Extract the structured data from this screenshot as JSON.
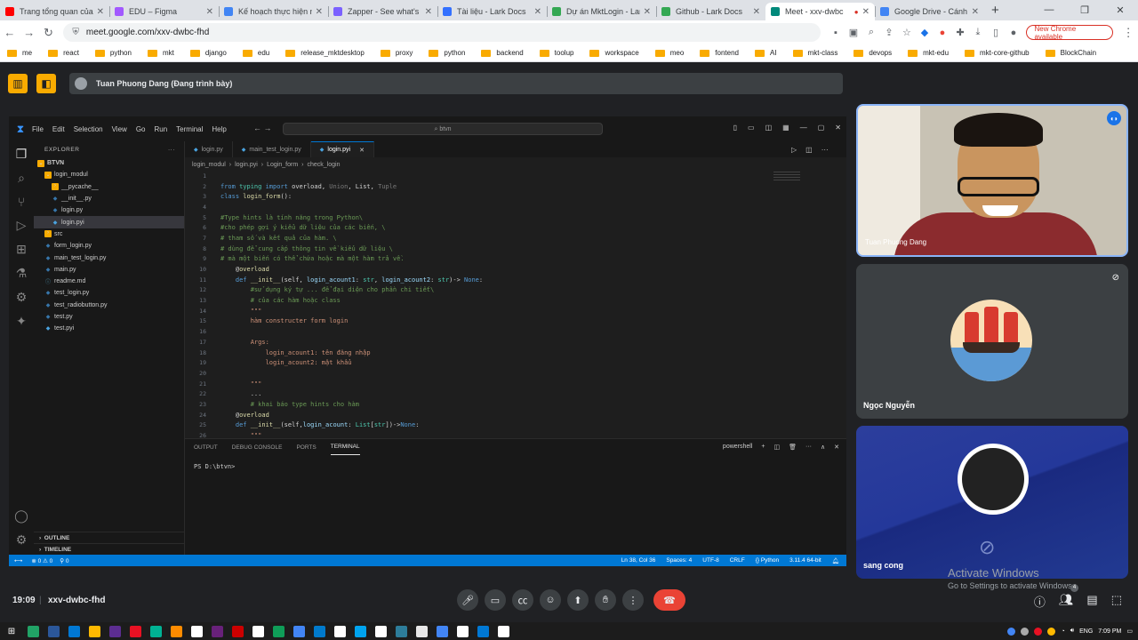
{
  "browser": {
    "tabs": [
      {
        "title": "Trang tổng quan của k",
        "color": "#ff0000"
      },
      {
        "title": "EDU – Figma",
        "color": "#a259ff"
      },
      {
        "title": "Kế hoạch thực hiện nh",
        "color": "#4285f4"
      },
      {
        "title": "Zapper - See what's h",
        "color": "#7b61ff"
      },
      {
        "title": "Tài liệu - Lark Docs",
        "color": "#3370ff"
      },
      {
        "title": "Dự án MktLogin - Lar",
        "color": "#34a853"
      },
      {
        "title": "Github - Lark Docs",
        "color": "#34a853"
      },
      {
        "title": "Meet - xxv-dwbc",
        "color": "#00897b"
      },
      {
        "title": "Google Drive - Cánh c",
        "color": "#4285f4"
      }
    ],
    "active_tab": 7,
    "new_tab": "+",
    "url": "meet.google.com/xxv-dwbc-fhd",
    "new_chrome": "New Chrome available",
    "bookmarks": [
      "me",
      "react",
      "python",
      "mkt",
      "django",
      "edu",
      "release_mktdesktop",
      "proxy",
      "python",
      "backend",
      "toolup",
      "workspace",
      "meo",
      "fontend",
      "AI",
      "mkt-class",
      "devops",
      "mkt-edu",
      "mkt-core-github",
      "BlockChain"
    ]
  },
  "meet": {
    "presenter": "Tuan Phuong Dang (Đang trình bày)",
    "time": "19:09",
    "meeting_code": "xxv-dwbc-fhd",
    "participants": [
      "Tuan Phuong Dang",
      "Ngọc Nguyễn",
      "sang cong"
    ],
    "people_badge": "4",
    "activate_title": "Activate Windows",
    "activate_sub": "Go to Settings to activate Windows."
  },
  "vscode": {
    "menu": [
      "File",
      "Edit",
      "Selection",
      "View",
      "Go",
      "Run",
      "Terminal",
      "Help"
    ],
    "search": "btvn",
    "explorer_title": "EXPLORER",
    "tree": [
      {
        "label": "BTVN",
        "indent": 0,
        "icon": "⌄",
        "kind": "folder",
        "bold": true
      },
      {
        "label": "login_modul",
        "indent": 1,
        "icon": "⌄",
        "kind": "folder"
      },
      {
        "label": "__pycache__",
        "indent": 2,
        "icon": "›",
        "kind": "folder"
      },
      {
        "label": "__init__.py",
        "indent": 2,
        "icon": "◆",
        "kind": "py"
      },
      {
        "label": "login.py",
        "indent": 2,
        "icon": "◆",
        "kind": "py"
      },
      {
        "label": "login.pyi",
        "indent": 2,
        "icon": "◆",
        "kind": "pyi",
        "selected": true
      },
      {
        "label": "src",
        "indent": 1,
        "icon": "›",
        "kind": "folder"
      },
      {
        "label": "form_login.py",
        "indent": 1,
        "icon": "◆",
        "kind": "py"
      },
      {
        "label": "main_test_login.py",
        "indent": 1,
        "icon": "◆",
        "kind": "py"
      },
      {
        "label": "main.py",
        "indent": 1,
        "icon": "◆",
        "kind": "py"
      },
      {
        "label": "readme.md",
        "indent": 1,
        "icon": "ⓘ",
        "kind": "md"
      },
      {
        "label": "test_login.py",
        "indent": 1,
        "icon": "◆",
        "kind": "py"
      },
      {
        "label": "test_radiobutton.py",
        "indent": 1,
        "icon": "◆",
        "kind": "py"
      },
      {
        "label": "test.py",
        "indent": 1,
        "icon": "◆",
        "kind": "py"
      },
      {
        "label": "test.pyi",
        "indent": 1,
        "icon": "◆",
        "kind": "pyi"
      }
    ],
    "outline": "OUTLINE",
    "timeline": "TIMELINE",
    "editor_tabs": [
      {
        "label": "login.py",
        "active": false
      },
      {
        "label": "main_test_login.py",
        "active": false
      },
      {
        "label": "login.pyi",
        "active": true
      }
    ],
    "breadcrumb": [
      "login_modul",
      "login.pyi",
      "Login_form",
      "check_login"
    ],
    "code_lines": [
      {
        "n": "1",
        "segs": []
      },
      {
        "n": "2",
        "segs": [
          [
            "kw",
            "from "
          ],
          [
            "ty",
            "typing "
          ],
          [
            "kw",
            "import "
          ],
          [
            "tx",
            "overload, "
          ],
          [
            "dim",
            "Union"
          ],
          [
            "tx",
            ", List, "
          ],
          [
            "dim",
            "Tuple"
          ]
        ]
      },
      {
        "n": "3",
        "segs": [
          [
            "kw",
            "class "
          ],
          [
            "fn",
            "login_form"
          ],
          [
            "tx",
            "():"
          ]
        ]
      },
      {
        "n": "4",
        "segs": []
      },
      {
        "n": "5",
        "segs": [
          [
            "cm",
            "#Type hints là tính năng trong Python\\"
          ]
        ]
      },
      {
        "n": "6",
        "segs": [
          [
            "cm",
            "#cho phép gợi ý kiểu dữ liệu của các biến, \\"
          ]
        ]
      },
      {
        "n": "7",
        "segs": [
          [
            "cm",
            "# tham số và kết quả của hàm. \\"
          ]
        ]
      },
      {
        "n": "8",
        "segs": [
          [
            "cm",
            "# dùng để cung cấp thông tin về kiểu dữ liệu \\"
          ]
        ]
      },
      {
        "n": "9",
        "segs": [
          [
            "cm",
            "# mà một biến có thể chứa hoặc mà một hàm trả về."
          ]
        ]
      },
      {
        "n": "10",
        "segs": [
          [
            "tx",
            "    @"
          ],
          [
            "fn",
            "overload"
          ]
        ]
      },
      {
        "n": "11",
        "segs": [
          [
            "tx",
            "    "
          ],
          [
            "kw",
            "def "
          ],
          [
            "fn",
            "__init__"
          ],
          [
            "tx",
            "(self, "
          ],
          [
            "pr",
            "login_acount1"
          ],
          [
            "tx",
            ": "
          ],
          [
            "ty",
            "str"
          ],
          [
            "tx",
            ", "
          ],
          [
            "pr",
            "login_acount2"
          ],
          [
            "tx",
            ": "
          ],
          [
            "ty",
            "str"
          ],
          [
            "tx",
            ")-> "
          ],
          [
            "kw",
            "None"
          ],
          [
            "tx",
            ":"
          ]
        ]
      },
      {
        "n": "12",
        "segs": [
          [
            "tx",
            "        "
          ],
          [
            "cm",
            "#sử dụng ký tự ... để đại diện cho phần chi tiết\\"
          ]
        ]
      },
      {
        "n": "13",
        "segs": [
          [
            "tx",
            "        "
          ],
          [
            "cm",
            "# của các hàm hoặc class"
          ]
        ]
      },
      {
        "n": "14",
        "segs": [
          [
            "tx",
            "        "
          ],
          [
            "dc",
            "\"\"\""
          ]
        ]
      },
      {
        "n": "15",
        "segs": [
          [
            "tx",
            "        "
          ],
          [
            "dc",
            "hàm constructer form login"
          ]
        ]
      },
      {
        "n": "16",
        "segs": []
      },
      {
        "n": "17",
        "segs": [
          [
            "tx",
            "        "
          ],
          [
            "dc",
            "Args:"
          ]
        ]
      },
      {
        "n": "18",
        "segs": [
          [
            "tx",
            "            "
          ],
          [
            "dc",
            "login_acount1: tên đăng nhập"
          ]
        ]
      },
      {
        "n": "19",
        "segs": [
          [
            "tx",
            "            "
          ],
          [
            "dc",
            "login_acount2: mật khẩu"
          ]
        ]
      },
      {
        "n": "20",
        "segs": []
      },
      {
        "n": "21",
        "segs": [
          [
            "tx",
            "        "
          ],
          [
            "dc",
            "\"\"\""
          ]
        ]
      },
      {
        "n": "22",
        "segs": [
          [
            "tx",
            "        ..."
          ]
        ]
      },
      {
        "n": "23",
        "segs": [
          [
            "tx",
            "        "
          ],
          [
            "cm",
            "# khai báo type hints cho hàm"
          ]
        ]
      },
      {
        "n": "24",
        "segs": [
          [
            "tx",
            "    @"
          ],
          [
            "fn",
            "overload"
          ]
        ]
      },
      {
        "n": "25",
        "segs": [
          [
            "tx",
            "    "
          ],
          [
            "kw",
            "def "
          ],
          [
            "fn",
            "__init__"
          ],
          [
            "tx",
            "(self,"
          ],
          [
            "pr",
            "login_acount"
          ],
          [
            "tx",
            ": "
          ],
          [
            "ty",
            "List"
          ],
          [
            "tx",
            "["
          ],
          [
            "ty",
            "str"
          ],
          [
            "tx",
            "])->"
          ],
          [
            "kw",
            "None"
          ],
          [
            "tx",
            ":"
          ]
        ]
      },
      {
        "n": "26",
        "segs": [
          [
            "tx",
            "        "
          ],
          [
            "dc",
            "\"\"\""
          ]
        ]
      }
    ],
    "panel_tabs": [
      {
        "label": "OUTPUT",
        "active": false
      },
      {
        "label": "DEBUG CONSOLE",
        "active": false
      },
      {
        "label": "PORTS",
        "active": false
      },
      {
        "label": "TERMINAL",
        "active": true
      }
    ],
    "shell": "powershell",
    "terminal_prompt": "PS D:\\btvn>",
    "status_left": [
      "⊗ 0 ⚠ 0",
      "⚲ 0"
    ],
    "status_right": [
      "Ln 38, Col 36",
      "Spaces: 4",
      "UTF-8",
      "CRLF",
      "{} Python",
      "3.11.4 64-bit"
    ]
  },
  "taskbar": {
    "apps": [
      "#21a366",
      "#2b579a",
      "#0078d4",
      "#ffb900",
      "#5c2d91",
      "#e81123",
      "#00b294",
      "#ff8c00",
      "#fff",
      "#68217a",
      "#c00",
      "#fff",
      "#0f9d58",
      "#4285f4",
      "#007acc",
      "#fff",
      "#00a4ef",
      "#fff",
      "#2d7d9a",
      "#e8e8e8",
      "#4285f4",
      "#fff",
      "#0078d4",
      "#fff"
    ],
    "lang": "ENG",
    "time": "7:09 PM"
  }
}
